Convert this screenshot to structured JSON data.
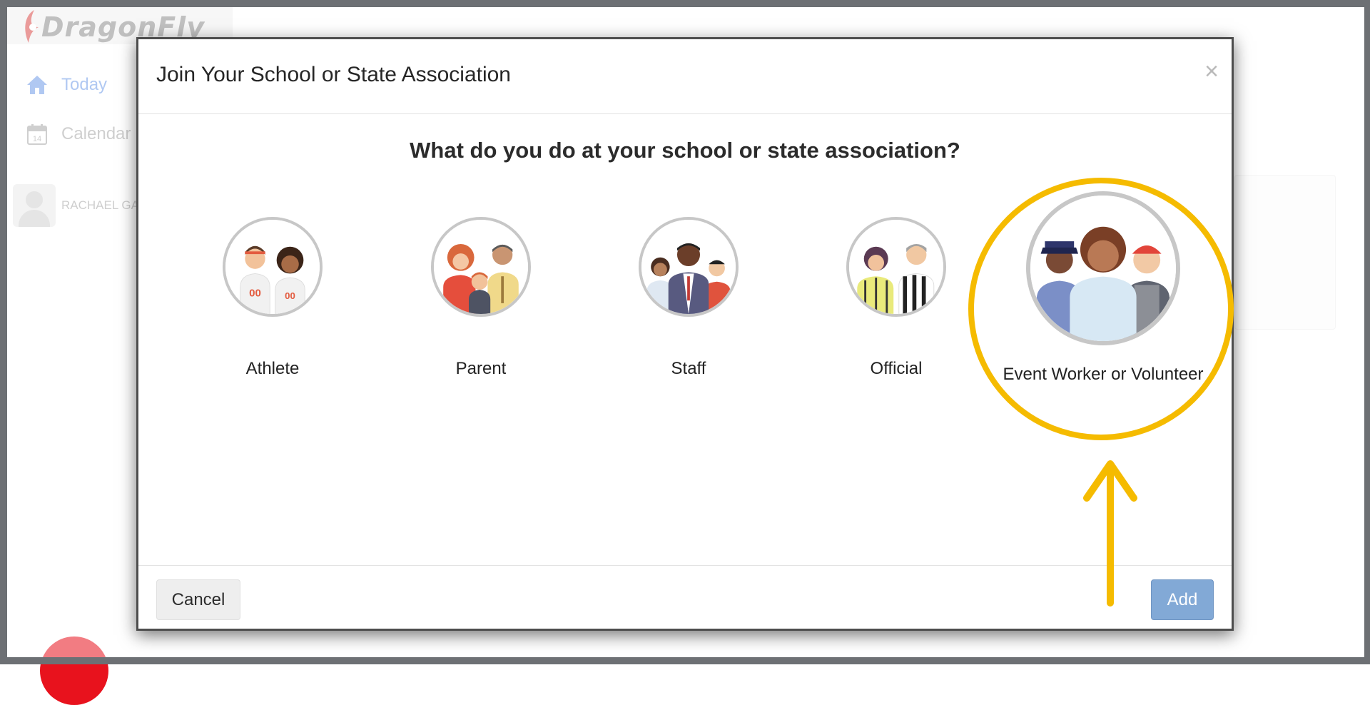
{
  "app": {
    "logo_text": "DragonFly"
  },
  "sidebar": {
    "items": [
      {
        "label": "Today",
        "icon": "home-icon",
        "active": true
      },
      {
        "label": "Calendar",
        "icon": "calendar-icon",
        "active": false
      }
    ],
    "calendar_icon_day": "14",
    "user_name": "RACHAEL GA"
  },
  "modal": {
    "title": "Join Your School or State Association",
    "close_symbol": "×",
    "question": "What do you do at your school or state association?",
    "roles": [
      {
        "label": "Athlete",
        "icon": "athlete-avatar-icon",
        "selected": false
      },
      {
        "label": "Parent",
        "icon": "parent-avatar-icon",
        "selected": false
      },
      {
        "label": "Staff",
        "icon": "staff-avatar-icon",
        "selected": false
      },
      {
        "label": "Official",
        "icon": "official-avatar-icon",
        "selected": false
      },
      {
        "label": "Event Worker or Volunteer",
        "icon": "event-worker-avatar-icon",
        "selected": true
      }
    ],
    "cancel_label": "Cancel",
    "add_label": "Add"
  },
  "colors": {
    "accent_link": "#6f9be8",
    "add_button": "#82a9d6",
    "highlight_ring": "#f5bb00",
    "frame": "#6d7074"
  }
}
